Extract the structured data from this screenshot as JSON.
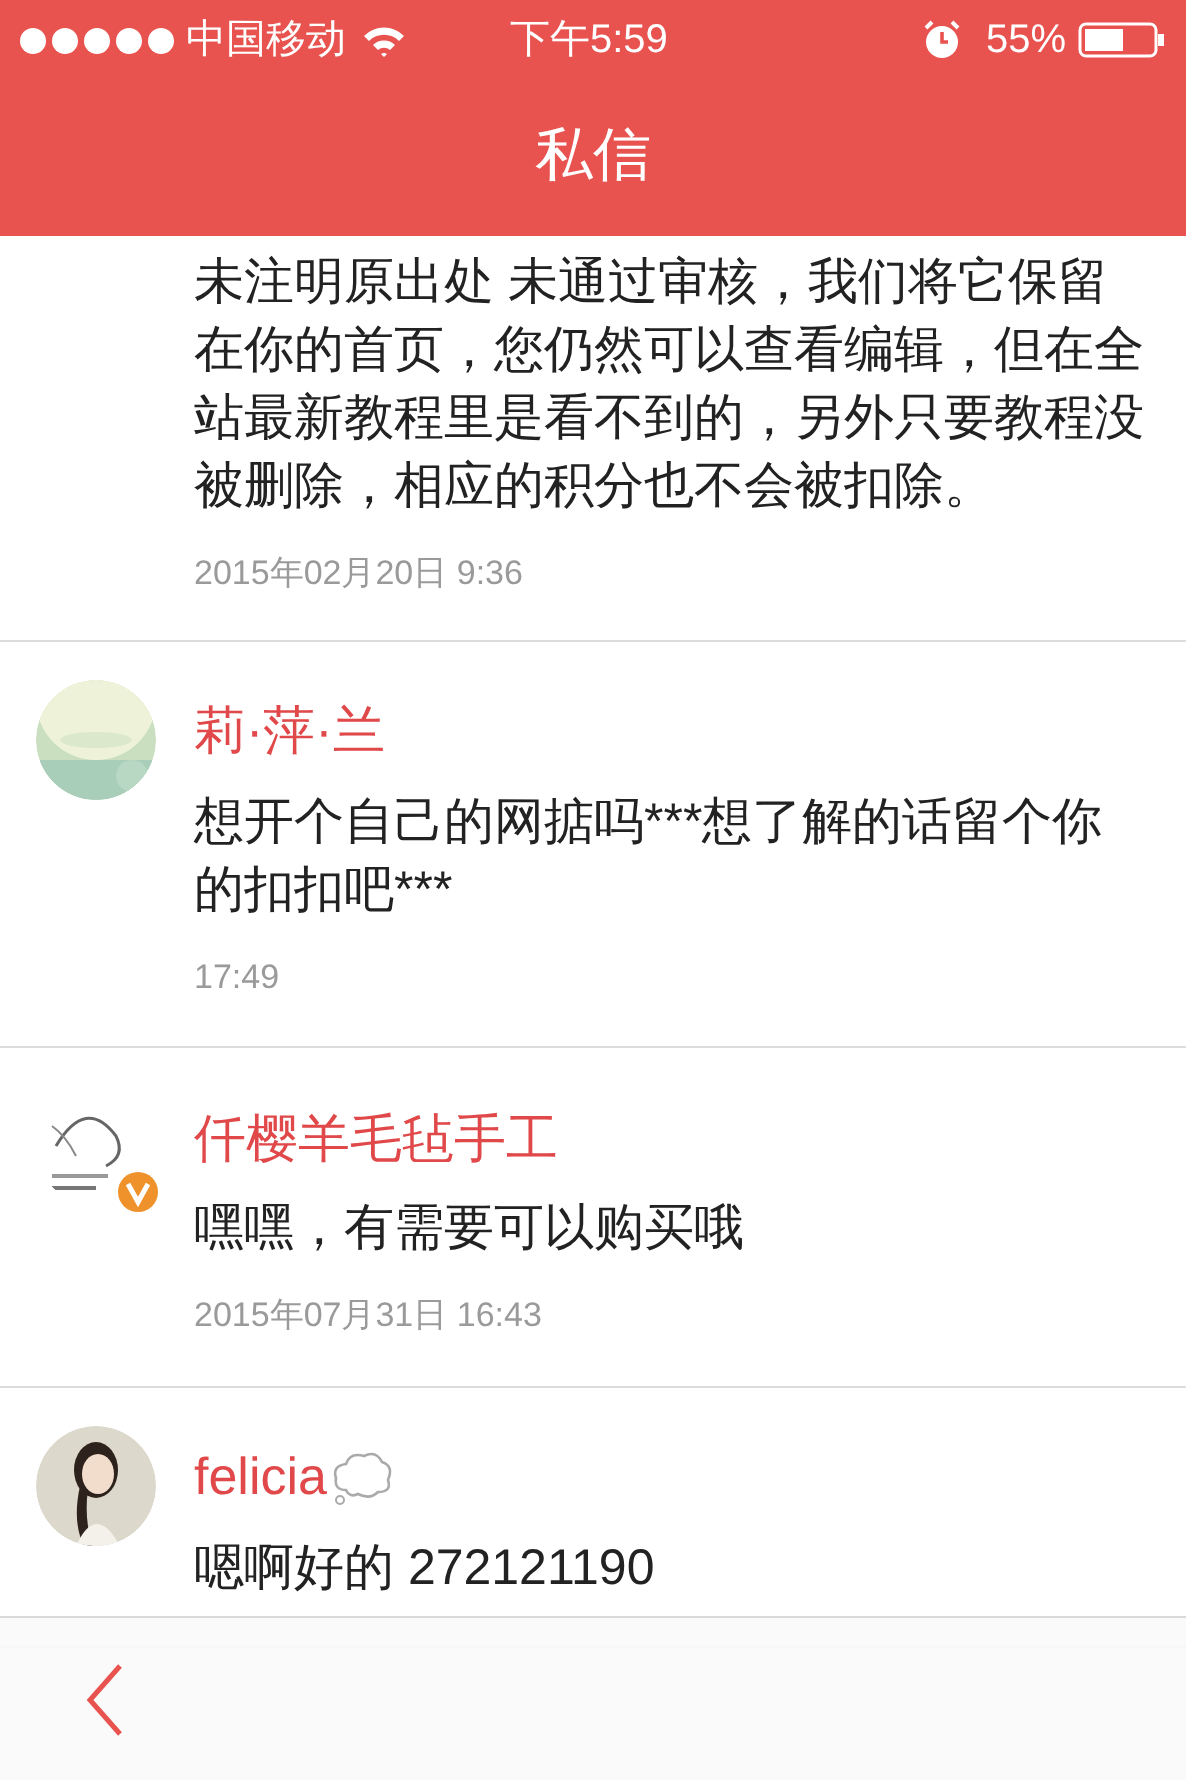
{
  "status_bar": {
    "carrier": "中国移动",
    "time": "下午5:59",
    "battery": "55%"
  },
  "nav_bar": {
    "title": "私信"
  },
  "messages": [
    {
      "text": "未注明原出处 未通过审核，我们将它保留在你的首页，您仍然可以查看编辑，但在全站最新教程里是看不到的，另外只要教程没被删除，相应的积分也不会被扣除。",
      "time": "2015年02月20日 9:36"
    },
    {
      "sender": "莉·萍·兰",
      "verified": false,
      "thought_bubble": false,
      "text": "想开个自己的网掂吗***想了解的话留个你的扣扣吧***",
      "time": "17:49"
    },
    {
      "sender": "仟樱羊毛毡手工",
      "verified": true,
      "thought_bubble": false,
      "text": "嘿嘿，有需要可以购买哦",
      "time": "2015年07月31日 16:43"
    },
    {
      "sender": "felicia",
      "verified": false,
      "thought_bubble": true,
      "text": "嗯啊好的 272121190"
    }
  ],
  "toolbar": {
    "back": true
  }
}
